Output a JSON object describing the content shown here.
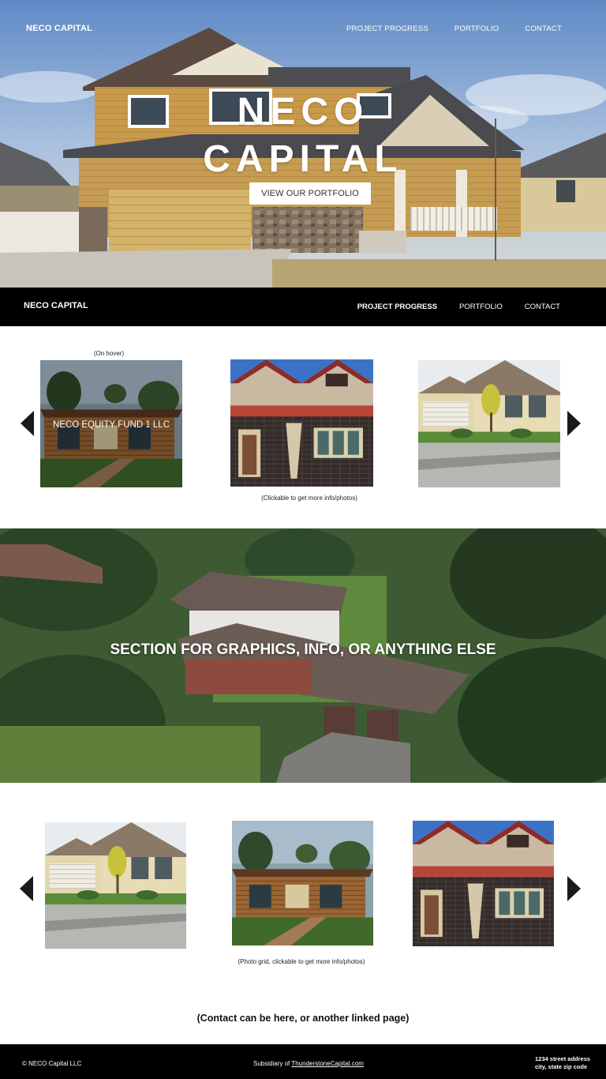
{
  "hero": {
    "brand": "NECO CAPITAL",
    "nav": [
      "PROJECT PROGRESS",
      "PORTFOLIO",
      "CONTACT"
    ],
    "title_line1": "NECO",
    "title_line2": "CAPITAL",
    "cta": "VIEW OUR PORTFOLIO"
  },
  "navbar": {
    "brand": "NECO CAPITAL",
    "items": [
      "PROJECT PROGRESS",
      "PORTFOLIO",
      "CONTACT"
    ],
    "active": "PROJECT PROGRESS"
  },
  "carousel1": {
    "hover_note": "(On hover)",
    "hover_label": "NECO EQUITY FUND 1 LLC",
    "caption": "(Clickable to get more info/photos)",
    "photos": [
      "modern-ranch-house",
      "tudor-brick-bungalow",
      "beige-cottage-house"
    ]
  },
  "banner": {
    "text": "SECTION FOR GRAPHICS, INFO, OR ANYTHING ELSE"
  },
  "carousel2": {
    "caption": "(Photo grid, clickable to get more info/photos)",
    "photos": [
      "beige-cottage-house",
      "modern-ranch-house",
      "tudor-brick-bungalow"
    ]
  },
  "contact": {
    "text": "(Contact can be here, or another linked page)"
  },
  "footer": {
    "copyright": "© NECO Capital LLC",
    "subsidiary_prefix": "Subsidiary of ",
    "subsidiary_link": "ThunderstoneCapital.com",
    "address_line1": "1234 street address",
    "address_line2": "city, state zip code"
  },
  "colors": {
    "nav_bar": "#000000",
    "footer": "#000000",
    "button_bg": "#ffffff",
    "arrow": "#1a1a1a"
  }
}
